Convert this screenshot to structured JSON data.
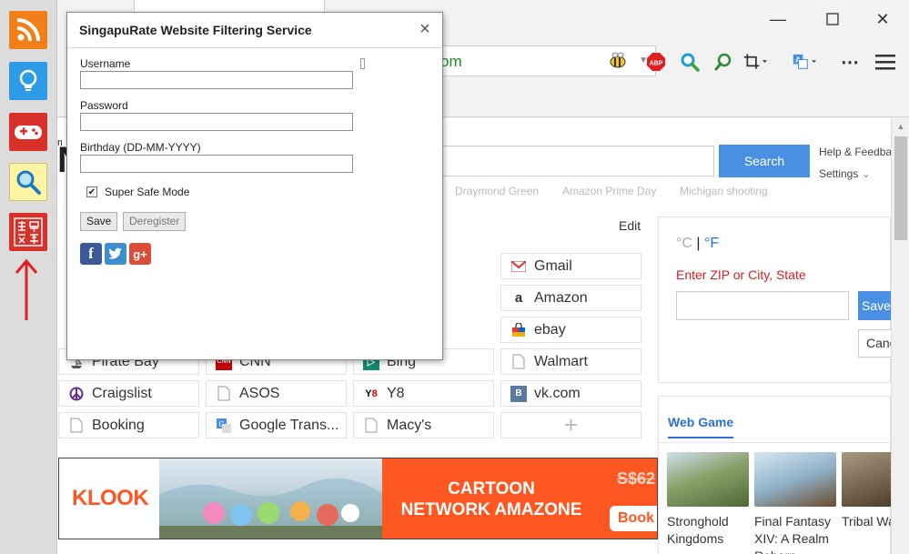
{
  "sidebar": {
    "buttons": [
      {
        "icon": "rss-icon",
        "color": "#f07e19"
      },
      {
        "icon": "lightbulb-icon",
        "color": "#2e9be6"
      },
      {
        "icon": "gamepad-icon",
        "color": "#d9302a"
      },
      {
        "icon": "magnifier-icon",
        "color": "#fff3a6"
      },
      {
        "icon": "seal-icon",
        "color": "#d9302a"
      }
    ],
    "annotation": "red-arrow-up"
  },
  "toolbar": {
    "address_text": "om",
    "icons": [
      "adblock-icon",
      "search-zoom-icon",
      "refresh-search-icon",
      "crop-icon",
      "translate-icon",
      "more-icon",
      "menu-icon"
    ]
  },
  "page": {
    "search_label": "Search",
    "help_label": "Help & Feedback",
    "settings_label": "Settings",
    "trends": [
      "Draymond Green",
      "Amazon Prime Day",
      "Michigan shooting"
    ],
    "edit_label": "Edit",
    "tiles": [
      {
        "label": "Gmail",
        "icon": "gmail-icon"
      },
      {
        "label": "Amazon",
        "icon": "amazon-icon"
      },
      {
        "label": "ebay",
        "icon": "ebay-icon"
      },
      {
        "label": "Pirate Bay",
        "icon": "pirate-icon"
      },
      {
        "label": "CNN",
        "icon": "cnn-icon"
      },
      {
        "label": "Bing",
        "icon": "bing-icon"
      },
      {
        "label": "Walmart",
        "icon": "page-icon"
      },
      {
        "label": "Craigslist",
        "icon": "peace-icon"
      },
      {
        "label": "ASOS",
        "icon": "page-icon"
      },
      {
        "label": "Y8",
        "icon": "y8-icon"
      },
      {
        "label": "vk.com",
        "icon": "vk-icon"
      },
      {
        "label": "Booking",
        "icon": "page-icon"
      },
      {
        "label": "Google Trans...",
        "icon": "google-translate-icon"
      },
      {
        "label": "Macy's",
        "icon": "page-icon"
      }
    ],
    "add_tile_label": "+"
  },
  "weather": {
    "celsius": "°C",
    "separator": "|",
    "fahrenheit": "°F",
    "prompt": "Enter ZIP or City, State",
    "save_label": "Save",
    "cancel_label": "Cancel"
  },
  "webgame": {
    "tab_label": "Web Game",
    "games": [
      {
        "name": "Stronghold Kingdoms",
        "color": "#6b8a4a"
      },
      {
        "name": "Final Fantasy XIV: A Realm Reborn",
        "color": "#8fb1c9"
      },
      {
        "name": "Tribal Wars",
        "color": "#6c5a44"
      }
    ]
  },
  "ad": {
    "logo": "KLOOK",
    "headline_line1": "CARTOON",
    "headline_line2": "NETWORK AMAZONE",
    "price": "S$62",
    "book_label": "Book"
  },
  "dialog": {
    "title": "SingapuRate Website Filtering Service",
    "close": "×",
    "username_label": "Username",
    "password_label": "Password",
    "birthday_label": "Birthday (DD-MM-YYYY)",
    "super_safe_label": "Super Safe Mode",
    "super_safe_checked": true,
    "save_label": "Save",
    "deregister_label": "Deregister",
    "social": [
      {
        "icon": "facebook-icon",
        "glyph": "f",
        "color": "#3b5998"
      },
      {
        "icon": "twitter-icon",
        "glyph": "t",
        "color": "#3d8dd1"
      },
      {
        "icon": "google-plus-icon",
        "glyph": "g+",
        "color": "#dd4b39"
      }
    ]
  }
}
